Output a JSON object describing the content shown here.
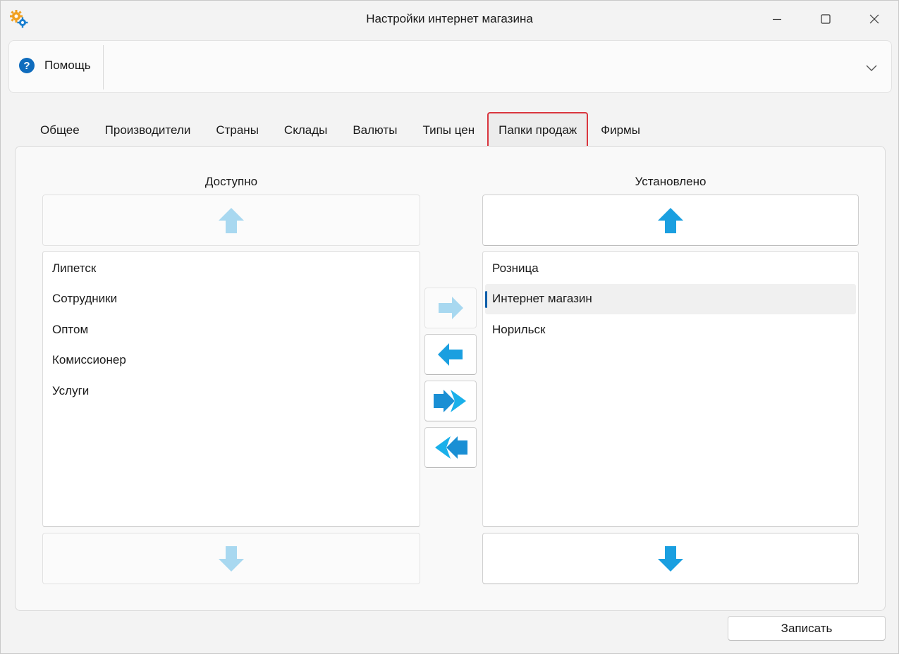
{
  "window": {
    "title": "Настройки интернет магазина"
  },
  "help": {
    "label": "Помощь"
  },
  "tabs": [
    {
      "label": "Общее"
    },
    {
      "label": "Производители"
    },
    {
      "label": "Страны"
    },
    {
      "label": "Склады"
    },
    {
      "label": "Валюты"
    },
    {
      "label": "Типы цен"
    },
    {
      "label": "Папки продаж",
      "active": true
    },
    {
      "label": "Фирмы"
    }
  ],
  "available": {
    "title": "Доступно",
    "items": [
      "Липетск",
      "Сотрудники",
      "Оптом",
      "Комиссионер",
      "Услуги"
    ]
  },
  "installed": {
    "title": "Установлено",
    "items": [
      "Розница",
      "Интернет магазин",
      "Норильск"
    ],
    "selected_index": 1
  },
  "buttons": {
    "save": "Записать"
  },
  "colors": {
    "accent": "#0f6cbd",
    "arrow_enabled": "#1a9fe0",
    "arrow_disabled": "#a8d8f0",
    "active_tab_border": "#d9363e",
    "selection_marker": "#0f5faa"
  },
  "icons": {
    "app": "gears-icon",
    "help": "question-circle-icon",
    "expand": "chevron-down-icon"
  }
}
